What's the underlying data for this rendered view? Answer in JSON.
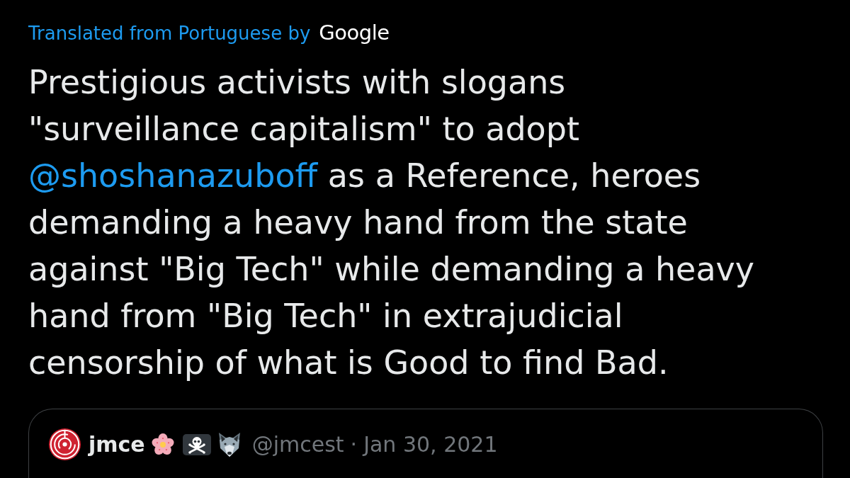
{
  "translation": {
    "label": "Translated from Portuguese by",
    "provider": "Google"
  },
  "tweet": {
    "segments": [
      {
        "kind": "text",
        "text": "Prestigious activists with slogans \"surveillance capitalism\" to adopt "
      },
      {
        "kind": "mention",
        "text": "@shoshanazuboff"
      },
      {
        "kind": "text",
        "text": " as a Reference, heroes demanding a heavy hand from the state against \"Big Tech\" while demanding a heavy hand from \"Big Tech\" in extrajudicial censorship of what is Good to find Bad."
      }
    ]
  },
  "quoted_tweet": {
    "author_name": "jmce",
    "handle": "@jmcest",
    "separator": "·",
    "date": "Jan 30, 2021"
  }
}
